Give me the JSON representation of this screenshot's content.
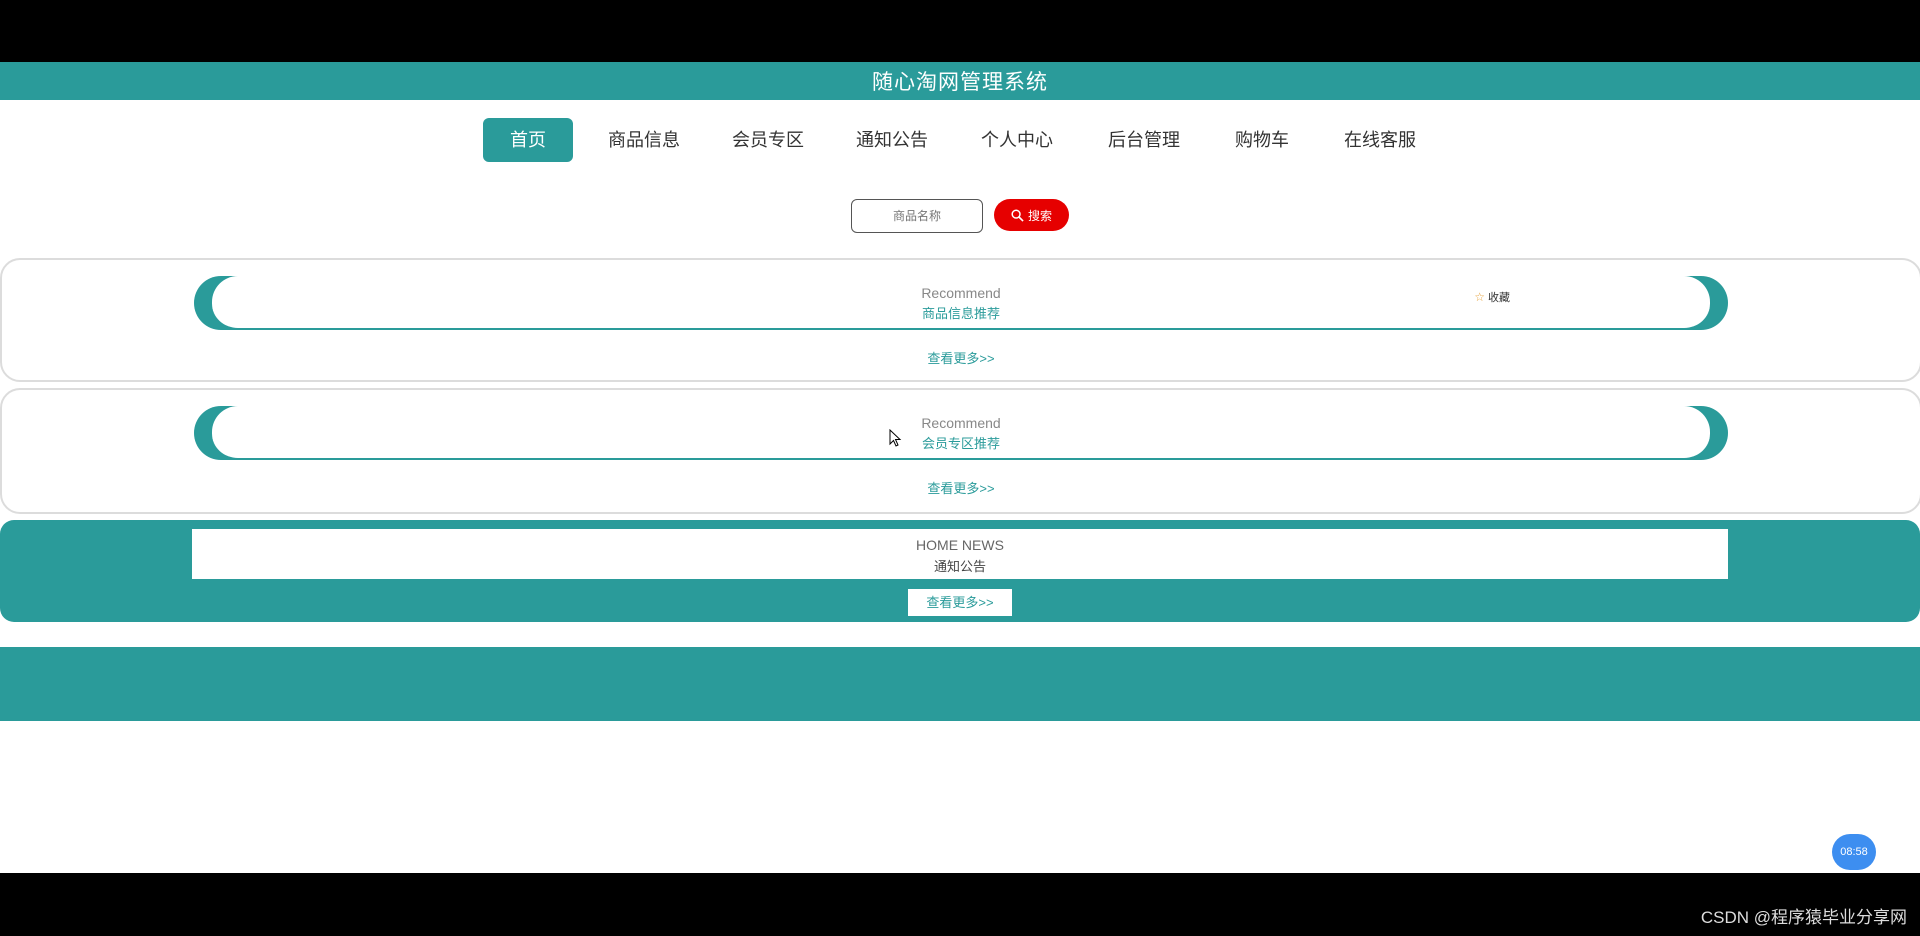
{
  "app": {
    "title": "随心淘网管理系统"
  },
  "nav": {
    "items": [
      {
        "label": "首页",
        "active": true
      },
      {
        "label": "商品信息"
      },
      {
        "label": "会员专区"
      },
      {
        "label": "通知公告"
      },
      {
        "label": "个人中心"
      },
      {
        "label": "后台管理"
      },
      {
        "label": "购物车"
      },
      {
        "label": "在线客服"
      }
    ]
  },
  "search": {
    "placeholder": "商品名称",
    "button_label": "搜索"
  },
  "sections": [
    {
      "en": "Recommend",
      "cn": "商品信息推荐",
      "favorite_label": "收藏",
      "more": "查看更多>>"
    },
    {
      "en": "Recommend",
      "cn": "会员专区推荐",
      "more": "查看更多>>"
    }
  ],
  "news": {
    "en": "HOME NEWS",
    "cn": "通知公告",
    "more": "查看更多>>"
  },
  "overlay": {
    "timer": "08:58",
    "watermark": "CSDN @程序猿毕业分享网"
  },
  "colors": {
    "primary": "#2a9b9a",
    "search_button": "#e60000",
    "timer_badge": "#3d8ef0"
  }
}
